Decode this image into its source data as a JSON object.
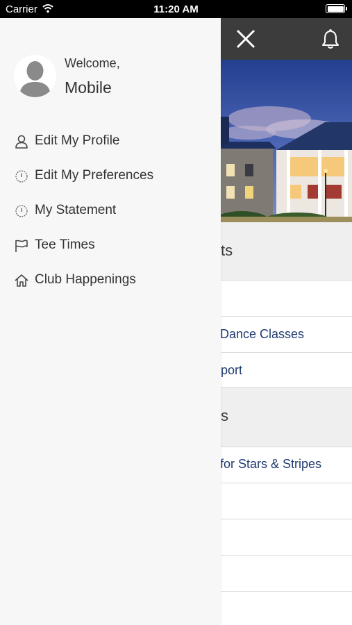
{
  "status_bar": {
    "carrier": "Carrier",
    "time": "11:20 AM"
  },
  "drawer": {
    "welcome": "Welcome,",
    "user_name": "Mobile",
    "items": [
      {
        "label": "Edit My Profile",
        "icon": "user-icon"
      },
      {
        "label": "Edit My Preferences",
        "icon": "clock-icon"
      },
      {
        "label": "My Statement",
        "icon": "clock-icon"
      },
      {
        "label": "Tee Times",
        "icon": "flag-icon"
      },
      {
        "label": "Club Happenings",
        "icon": "home-icon"
      }
    ]
  },
  "background": {
    "section1": "ts",
    "item1": "Dance Classes",
    "item2": "port",
    "section2": "s",
    "item3": "for Stars & Stripes"
  },
  "colors": {
    "topbar": "#3c3c3c",
    "link": "#1f3a70",
    "drawer_bg": "#f7f7f7",
    "section_bg": "#efefef"
  }
}
